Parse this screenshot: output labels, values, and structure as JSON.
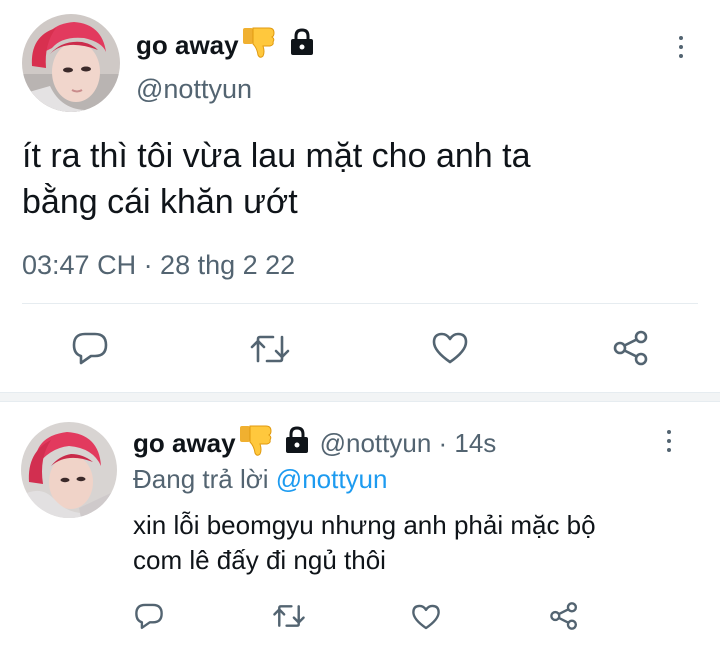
{
  "main_tweet": {
    "display_name": "go away",
    "handle": "@nottyun",
    "text_line1": "ít ra thì tôi vừa lau mặt cho anh ta",
    "text_line2": "bằng cái khăn ướt",
    "timestamp": "03:47 CH · 28 thg 2 22"
  },
  "reply_tweet": {
    "display_name": "go away",
    "handle_time": "@nottyun · 14s",
    "replying_prefix": "Đang trả lời",
    "replying_to": "@nottyun",
    "text_line1": "xin lỗi beomgyu nhưng anh phải mặc bộ",
    "text_line2": "com lê đấy đi ngủ thôi"
  },
  "icons": [
    "thumbs-down-icon",
    "lock-icon",
    "more-icon",
    "reply-icon",
    "retweet-icon",
    "like-icon",
    "share-icon"
  ],
  "colors": {
    "text": "#0f1419",
    "secondary": "#536471",
    "accent": "#1d9bf0",
    "divider": "#e6ecf0"
  }
}
